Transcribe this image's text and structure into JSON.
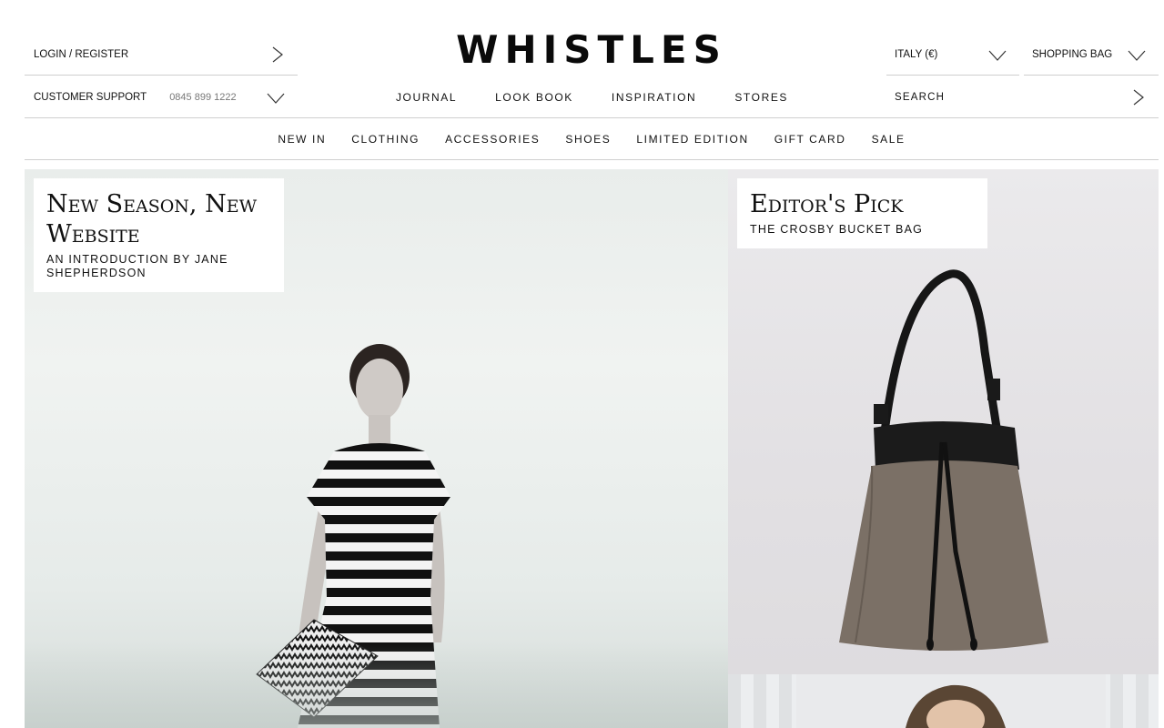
{
  "header": {
    "logo": "WHISTLES",
    "login_label": "LOGIN / REGISTER",
    "support_label": "CUSTOMER SUPPORT",
    "support_phone": "0845 899 1222",
    "country_label": "ITALY (€)",
    "bag_label": "SHOPPING BAG",
    "search_placeholder": "SEARCH"
  },
  "secondary_nav": [
    "JOURNAL",
    "LOOK BOOK",
    "INSPIRATION",
    "STORES"
  ],
  "main_nav": [
    "NEW IN",
    "CLOTHING",
    "ACCESSORIES",
    "SHOES",
    "LIMITED EDITION",
    "GIFT CARD",
    "SALE"
  ],
  "promos": {
    "left": {
      "title": "New Season, New Website",
      "subtitle": "AN INTRODUCTION BY JANE SHEPHERDSON"
    },
    "right": {
      "title": "Editor's Pick",
      "subtitle": "THE CROSBY BUCKET BAG"
    }
  },
  "icons": {
    "chevron_right": "chevron-right-icon",
    "chevron_down": "chevron-down-icon"
  },
  "colors": {
    "text": "#111111",
    "divider": "#cfcfcf",
    "muted": "#777777"
  }
}
